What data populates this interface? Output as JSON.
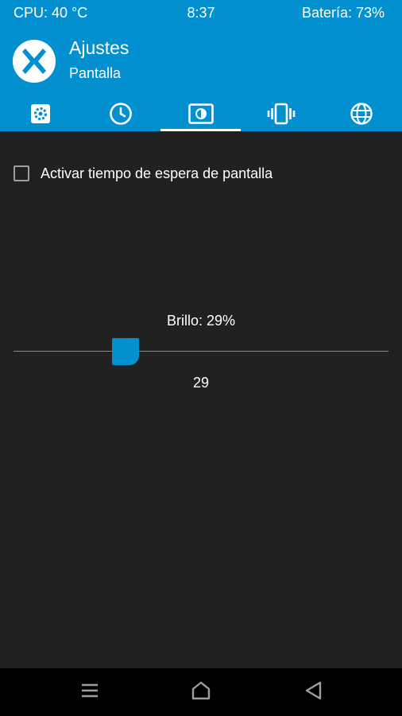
{
  "statusbar": {
    "cpu": "CPU: 40 °C",
    "clock": "8:37",
    "battery": "Batería: 73%"
  },
  "header": {
    "title": "Ajustes",
    "subtitle": "Pantalla",
    "logo_icon": "twrp-logo-icon"
  },
  "tabs": [
    {
      "icon": "settings-gear-icon",
      "active": false
    },
    {
      "icon": "clock-icon",
      "active": false
    },
    {
      "icon": "screen-brightness-icon",
      "active": true
    },
    {
      "icon": "vibration-icon",
      "active": false
    },
    {
      "icon": "globe-icon",
      "active": false
    }
  ],
  "screen_timeout": {
    "label": "Activar tiempo de espera de pantalla",
    "checked": false
  },
  "brightness": {
    "label": "Brillo: 29%",
    "value": 29,
    "value_text": "29",
    "max": 100
  },
  "navbar": {
    "icons": [
      "menu-icon",
      "home-icon",
      "back-icon"
    ]
  },
  "colors": {
    "accent": "#0290d1",
    "background": "#212121",
    "navbar": "#000000"
  }
}
